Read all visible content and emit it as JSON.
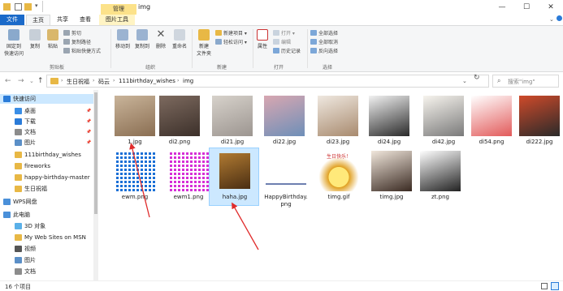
{
  "window": {
    "title": "img",
    "manage_tab": "管理",
    "min": "—",
    "max": "☐",
    "close": "✕"
  },
  "tabs": {
    "file": "文件",
    "home": "主页",
    "share": "共享",
    "view": "查看",
    "picture_tools": "图片工具"
  },
  "ribbon": {
    "pin": "固定到\n快速访问",
    "copy": "复制",
    "paste": "粘贴",
    "cut": "剪切",
    "copy_path": "复制路径",
    "paste_shortcut": "粘贴快捷方式",
    "group_clipboard": "剪贴板",
    "move_to": "移动到",
    "copy_to": "复制到",
    "delete": "删除",
    "rename": "重命名",
    "group_organize": "组织",
    "new_folder": "新建\n文件夹",
    "new_item": "新建项目",
    "easy_access": "轻松访问",
    "group_new": "新建",
    "properties": "属性",
    "open": "打开",
    "edit": "编辑",
    "history": "历史记录",
    "group_open": "打开",
    "select_all": "全部选择",
    "select_none": "全部取消",
    "invert": "反向选择",
    "group_select": "选择"
  },
  "address": {
    "crumbs": [
      "生日祝福",
      "码云",
      "111birthday_wishes",
      "img"
    ],
    "search_placeholder": "搜索\"img\""
  },
  "nav_pane": [
    {
      "label": "快速访问",
      "icon": "star-icon",
      "color": "#2a7bd8",
      "pinned": false,
      "selected": true
    },
    {
      "label": "桌面",
      "icon": "desktop-icon",
      "color": "#3a8ee6",
      "pinned": true
    },
    {
      "label": "下载",
      "icon": "download-icon",
      "color": "#2a7bd8",
      "pinned": true
    },
    {
      "label": "文档",
      "icon": "document-icon",
      "color": "#8c8c8c",
      "pinned": true
    },
    {
      "label": "图片",
      "icon": "picture-icon",
      "color": "#5b8fc7",
      "pinned": true
    },
    {
      "label": "111birthday_wishes",
      "icon": "folder-icon",
      "color": "#e8b845",
      "pinned": false
    },
    {
      "label": "fireworks",
      "icon": "folder-icon",
      "color": "#e8b845",
      "pinned": false
    },
    {
      "label": "happy-birthday-master",
      "icon": "folder-icon",
      "color": "#e8b845",
      "pinned": false
    },
    {
      "label": "生日祝福",
      "icon": "folder-icon",
      "color": "#e8b845",
      "pinned": false
    },
    {
      "label": "WPS网盘",
      "icon": "cloud-icon",
      "color": "#4a90d9",
      "pinned": false
    },
    {
      "label": "此电脑",
      "icon": "computer-icon",
      "color": "#4a90d9",
      "pinned": false
    },
    {
      "label": "3D 对象",
      "icon": "cube-icon",
      "color": "#5ab0e8",
      "pinned": false
    },
    {
      "label": "My Web Sites on MSN",
      "icon": "web-folder-icon",
      "color": "#e8b845",
      "pinned": false
    },
    {
      "label": "视频",
      "icon": "video-icon",
      "color": "#555",
      "pinned": false
    },
    {
      "label": "图片",
      "icon": "picture-icon",
      "color": "#5b8fc7",
      "pinned": false
    },
    {
      "label": "文档",
      "icon": "document-icon",
      "color": "#8c8c8c",
      "pinned": false
    }
  ],
  "files": [
    {
      "name": "1.jpg",
      "thumb": "dog-photo",
      "colors": [
        "#c9b49a",
        "#8a6e52"
      ]
    },
    {
      "name": "di2.png",
      "thumb": "cat-photo",
      "colors": [
        "#7d6a5f",
        "#3c302a"
      ]
    },
    {
      "name": "di21.jpg",
      "thumb": "cat-drawing",
      "colors": [
        "#d7d2cb",
        "#9c9590"
      ]
    },
    {
      "name": "di22.jpg",
      "thumb": "cake-photo",
      "colors": [
        "#d8a7b1",
        "#6e8fb8"
      ]
    },
    {
      "name": "di23.jpg",
      "thumb": "character-drawing",
      "colors": [
        "#efe8e0",
        "#a88a6e"
      ]
    },
    {
      "name": "di24.jpg",
      "thumb": "cartoon-cat",
      "colors": [
        "#f2f2f2",
        "#2a2a2a"
      ]
    },
    {
      "name": "di42.jpg",
      "thumb": "sticker",
      "colors": [
        "#f7f4ee",
        "#7a7a7a"
      ]
    },
    {
      "name": "di54.png",
      "thumb": "birthday-cake",
      "colors": [
        "#ffffff",
        "#e25a5a"
      ]
    },
    {
      "name": "di222.jpg",
      "thumb": "rooster",
      "colors": [
        "#cf4a2a",
        "#2a2a2a"
      ]
    },
    {
      "name": "ewm.png",
      "thumb": "qr-blue",
      "colors": [
        "#ffffff",
        "#1a6fd6"
      ]
    },
    {
      "name": "ewm1.png",
      "thumb": "qr-pink",
      "colors": [
        "#ffffff",
        "#d62fd6"
      ]
    },
    {
      "name": "haha.jpg",
      "thumb": "lion",
      "colors": [
        "#b07a32",
        "#4a2e12"
      ]
    },
    {
      "name": "HappyBirthday.png",
      "thumb": "banner",
      "colors": [
        "#ffffff",
        "#6d7fb0"
      ]
    },
    {
      "name": "timg.gif",
      "thumb": "chick",
      "colors": [
        "#ffe97a",
        "#e0a020"
      ],
      "caption": "生日快乐！"
    },
    {
      "name": "timg.jpg",
      "thumb": "bird-drawing",
      "colors": [
        "#f1e7dc",
        "#3a2a22"
      ]
    },
    {
      "name": "zt.png",
      "thumb": "goose",
      "colors": [
        "#ffffff",
        "#222222"
      ]
    }
  ],
  "status": {
    "count": "16 个项目"
  },
  "accent": "#1b6ac9",
  "arrow_color": "#e02b2b"
}
